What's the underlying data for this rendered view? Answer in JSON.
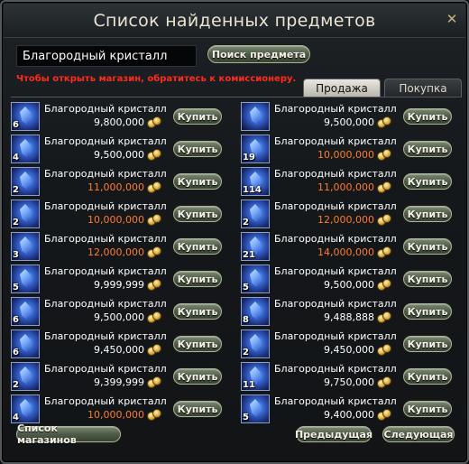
{
  "window": {
    "title": "Список найденных предметов",
    "close_glyph": "✕"
  },
  "search": {
    "value": "Благородный кристалл",
    "button_label": "Поиск предмета"
  },
  "notice": "Чтобы открыть магазин, обратитесь к комиссионеру.",
  "tabs": [
    {
      "label": "Продажа",
      "active": true
    },
    {
      "label": "Покупка",
      "active": false
    }
  ],
  "items": [
    {
      "qty": "6",
      "name": "Благородный кристалл",
      "price": "9,800,000",
      "price_color": "#ffffff",
      "buy": "Купить"
    },
    {
      "qty": "",
      "name": "Благородный кристалл",
      "price": "9,500,000",
      "price_color": "#ffffff",
      "buy": "Купить"
    },
    {
      "qty": "4",
      "name": "Благородный кристалл",
      "price": "9,500,000",
      "price_color": "#ffffff",
      "buy": "Купить"
    },
    {
      "qty": "19",
      "name": "Благородный кристалл",
      "price": "10,000,000",
      "price_color": "#ff7b2c",
      "buy": "Купить"
    },
    {
      "qty": "2",
      "name": "Благородный кристалл",
      "price": "11,000,000",
      "price_color": "#ff7b2c",
      "buy": "Купить"
    },
    {
      "qty": "114",
      "name": "Благородный кристалл",
      "price": "11,000,000",
      "price_color": "#ff7b2c",
      "buy": "Купить"
    },
    {
      "qty": "2",
      "name": "Благородный кристалл",
      "price": "10,000,000",
      "price_color": "#ff7b2c",
      "buy": "Купить"
    },
    {
      "qty": "2",
      "name": "Благородный кристалл",
      "price": "12,000,000",
      "price_color": "#ff7b2c",
      "buy": "Купить"
    },
    {
      "qty": "3",
      "name": "Благородный кристалл",
      "price": "12,000,000",
      "price_color": "#ff7b2c",
      "buy": "Купить"
    },
    {
      "qty": "21",
      "name": "Благородный кристалл",
      "price": "14,000,000",
      "price_color": "#ff7b2c",
      "buy": "Купить"
    },
    {
      "qty": "5",
      "name": "Благородный кристалл",
      "price": "9,999,999",
      "price_color": "#ffffff",
      "buy": "Купить"
    },
    {
      "qty": "5",
      "name": "Благородный кристалл",
      "price": "9,500,000",
      "price_color": "#ffffff",
      "buy": "Купить"
    },
    {
      "qty": "6",
      "name": "Благородный кристалл",
      "price": "9,500,000",
      "price_color": "#ffffff",
      "buy": "Купить"
    },
    {
      "qty": "8",
      "name": "Благородный кристалл",
      "price": "9,488,888",
      "price_color": "#ffffff",
      "buy": "Купить"
    },
    {
      "qty": "6",
      "name": "Благородный кристалл",
      "price": "9,450,000",
      "price_color": "#ffffff",
      "buy": "Купить"
    },
    {
      "qty": "2",
      "name": "Благородный кристалл",
      "price": "9,450,000",
      "price_color": "#ffffff",
      "buy": "Купить"
    },
    {
      "qty": "2",
      "name": "Благородный кристалл",
      "price": "9,399,999",
      "price_color": "#ffffff",
      "buy": "Купить"
    },
    {
      "qty": "11",
      "name": "Благородный кристалл",
      "price": "9,750,000",
      "price_color": "#ffffff",
      "buy": "Купить"
    },
    {
      "qty": "4",
      "name": "Благородный кристалл",
      "price": "10,000,000",
      "price_color": "#ff7b2c",
      "buy": "Купить"
    },
    {
      "qty": "5",
      "name": "Благородный кристалл",
      "price": "9,400,000",
      "price_color": "#ffffff",
      "buy": "Купить"
    }
  ],
  "footer": {
    "shops_label": "Список магазинов",
    "prev_label": "Предыдущая",
    "next_label": "Следующая"
  },
  "icons": {
    "item": "crystal-icon",
    "currency": "coins-icon",
    "close": "close-icon"
  }
}
